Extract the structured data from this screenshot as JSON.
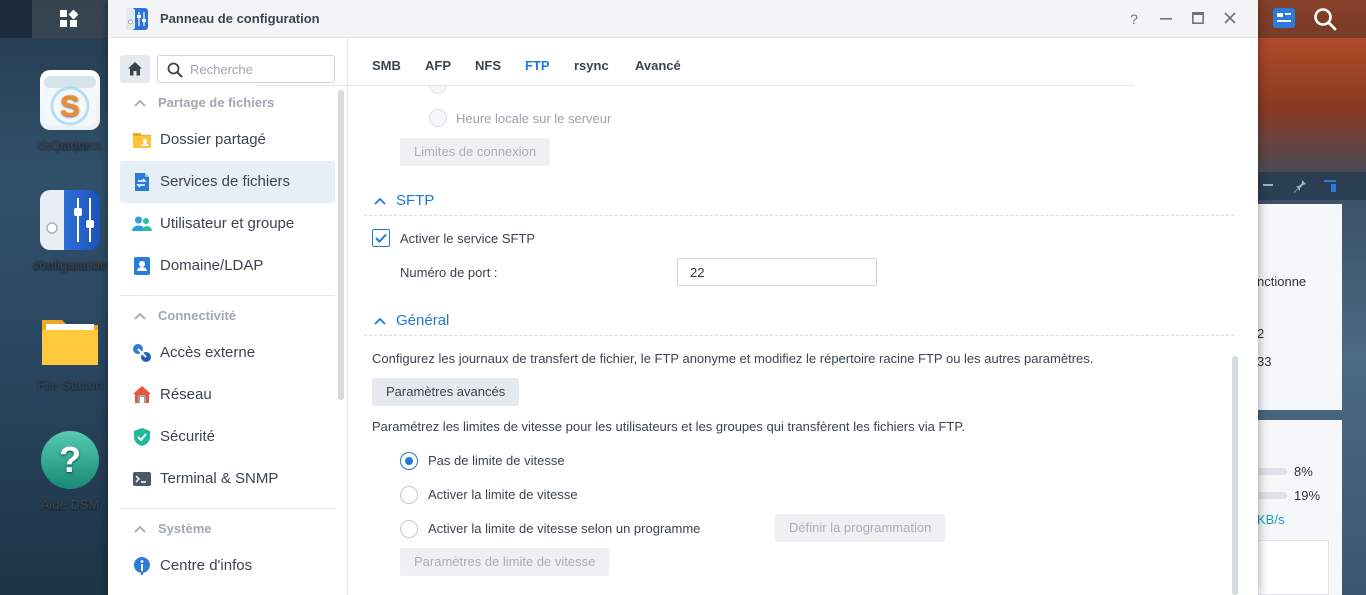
{
  "desktop": {
    "apps": [
      {
        "label_line1": "Centre",
        "label_line2": "de paquets"
      },
      {
        "label_line1": "Panneau de",
        "label_line2": "configuration"
      },
      {
        "label_line1": "File Station",
        "label_line2": ""
      },
      {
        "label_line1": "Aide DSM",
        "label_line2": ""
      }
    ],
    "widget": {
      "text1": "nctionne",
      "val1": "2",
      "val2": "33",
      "pct1": "8%",
      "pct2": "19%",
      "speed": "KB/s"
    }
  },
  "window": {
    "title": "Panneau de configuration",
    "controls": {
      "help": "?",
      "minimize": "—",
      "maximize": "▢",
      "close": "✕"
    }
  },
  "sidebar": {
    "search_placeholder": "Recherche",
    "groups": [
      {
        "label": "Partage de fichiers"
      },
      {
        "label": "Connectivité"
      },
      {
        "label": "Système"
      }
    ],
    "items": [
      {
        "label": "Dossier partagé",
        "icon": "shared-folder-icon"
      },
      {
        "label": "Services de fichiers",
        "icon": "file-services-icon",
        "active": true
      },
      {
        "label": "Utilisateur et groupe",
        "icon": "users-icon"
      },
      {
        "label": "Domaine/LDAP",
        "icon": "domain-icon"
      },
      {
        "label": "Accès externe",
        "icon": "external-access-icon"
      },
      {
        "label": "Réseau",
        "icon": "network-icon"
      },
      {
        "label": "Sécurité",
        "icon": "security-icon"
      },
      {
        "label": "Terminal & SNMP",
        "icon": "terminal-icon"
      },
      {
        "label": "Centre d'infos",
        "icon": "info-icon"
      }
    ]
  },
  "tabs": [
    {
      "label": "SMB"
    },
    {
      "label": "AFP"
    },
    {
      "label": "NFS"
    },
    {
      "label": "FTP",
      "active": true
    },
    {
      "label": "rsync"
    },
    {
      "label": "Avancé"
    }
  ],
  "ftp": {
    "time_option_local": "Heure locale sur le serveur",
    "connection_limits_button": "Limites de connexion",
    "sftp": {
      "heading": "SFTP",
      "enable_label": "Activer le service SFTP",
      "enabled": true,
      "port_label": "Numéro de port :",
      "port_value": "22"
    },
    "general": {
      "heading": "Général",
      "description": "Configurez les journaux de transfert de fichier, le FTP anonyme et modifiez le répertoire racine FTP ou les autres paramètres.",
      "advanced_button": "Paramètres avancés",
      "speed_description": "Paramétrez les limites de vitesse pour les utilisateurs et les groupes qui transfèrent les fichiers via FTP.",
      "speed_options": [
        {
          "label": "Pas de limite de vitesse",
          "selected": true
        },
        {
          "label": "Activer la limite de vitesse",
          "selected": false
        },
        {
          "label": "Activer la limite de vitesse selon un programme",
          "selected": false
        }
      ],
      "schedule_button": "Définir la programmation",
      "speed_settings_button": "Paramètres de limite de vitesse"
    }
  },
  "colors": {
    "accent": "#1e7ad6",
    "active_item_bg": "#e6eef6"
  }
}
